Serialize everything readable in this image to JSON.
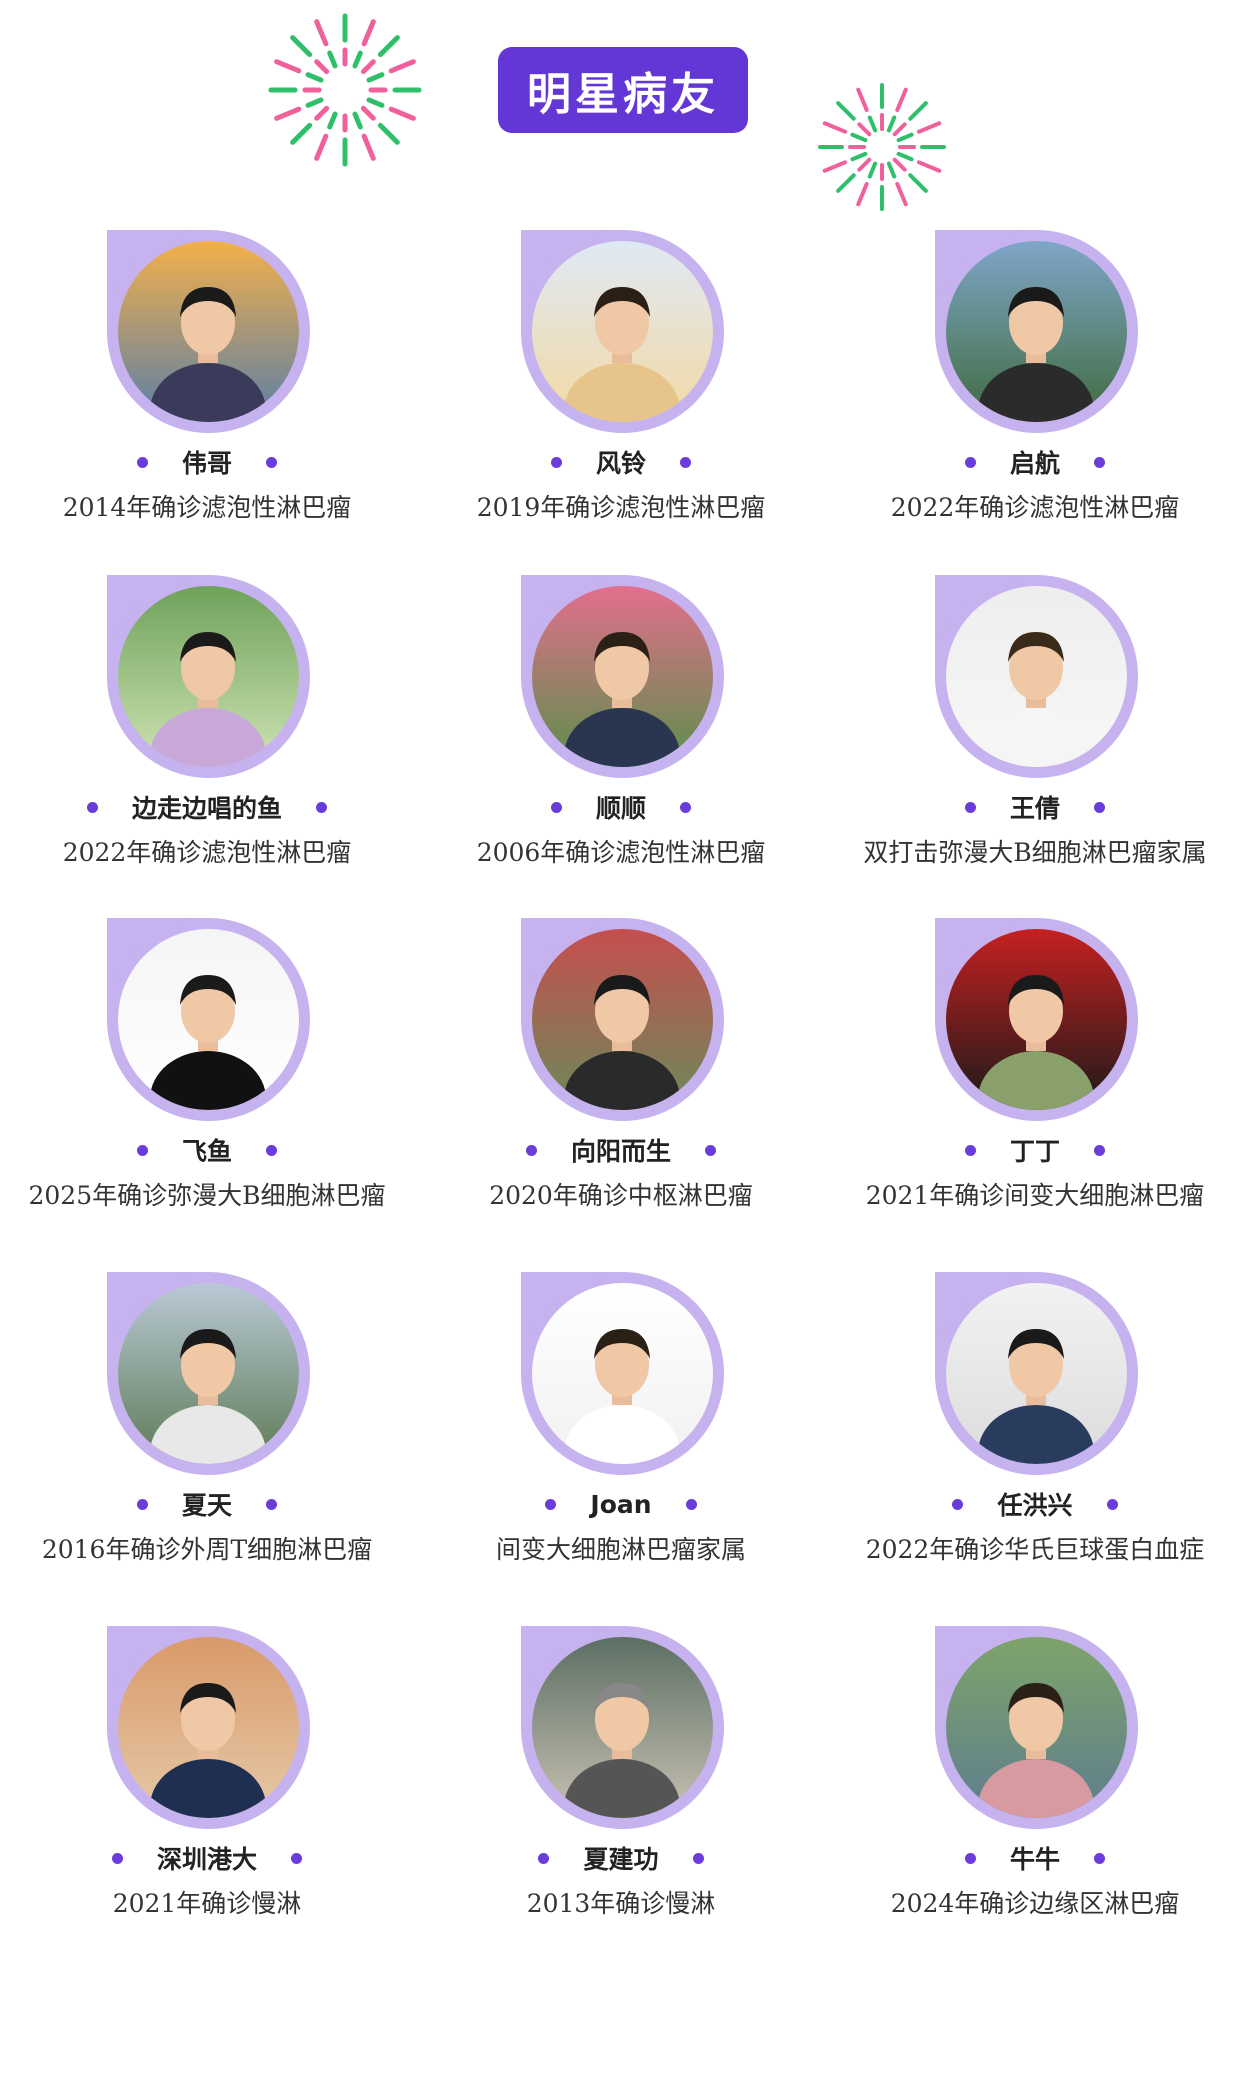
{
  "header": {
    "title": "明星病友"
  },
  "colors": {
    "accent": "#6237d6",
    "ring": "#c5b2ee",
    "dot": "#6a3cd9",
    "firework_green": "#2fbf6a",
    "firework_pink": "#f0609a"
  },
  "patients": [
    {
      "name": "伟哥",
      "desc": "2014年确诊滤泡性淋巴瘤",
      "photo": "avatar-photo-man-on-ship-sunset"
    },
    {
      "name": "风铃",
      "desc": "2019年确诊滤泡性淋巴瘤",
      "photo": "avatar-photo-woman-peace-sign-sky"
    },
    {
      "name": "启航",
      "desc": "2022年确诊滤泡性淋巴瘤",
      "photo": "avatar-photo-man-thumbs-up-lake"
    },
    {
      "name": "边走边唱的鱼",
      "desc": "2022年确诊滤泡性淋巴瘤",
      "photo": "avatar-photo-woman-sunglasses-garden"
    },
    {
      "name": "顺顺",
      "desc": "2006年确诊滤泡性淋巴瘤",
      "photo": "avatar-photo-woman-flowers"
    },
    {
      "name": "王倩",
      "desc": "双打击弥漫大B细胞淋巴瘤家属",
      "photo": "avatar-photo-woman-chair-studio"
    },
    {
      "name": "飞鱼",
      "desc": "2025年确诊弥漫大B细胞淋巴瘤",
      "photo": "avatar-photo-man-suit-sitting"
    },
    {
      "name": "向阳而生",
      "desc": "2020年确诊中枢淋巴瘤",
      "photo": "avatar-photo-family-group"
    },
    {
      "name": "丁丁",
      "desc": "2021年确诊间变大细胞淋巴瘤",
      "photo": "avatar-photo-woman-red-background"
    },
    {
      "name": "夏天",
      "desc": "2016年确诊外周T细胞淋巴瘤",
      "photo": "avatar-photo-man-great-wall"
    },
    {
      "name": "Joan",
      "desc": "间变大细胞淋巴瘤家属",
      "photo": "avatar-photo-woman-portrait"
    },
    {
      "name": "任洪兴",
      "desc": "2022年确诊华氏巨球蛋白血症",
      "photo": "avatar-photo-man-cap"
    },
    {
      "name": "深圳港大",
      "desc": "2021年确诊慢淋",
      "photo": "avatar-photo-man-smiling"
    },
    {
      "name": "夏建功",
      "desc": "2013年确诊慢淋",
      "photo": "avatar-photo-man-glasses"
    },
    {
      "name": "牛牛",
      "desc": "2024年确诊边缘区淋巴瘤",
      "photo": "avatar-photo-woman-pond-garden"
    }
  ]
}
